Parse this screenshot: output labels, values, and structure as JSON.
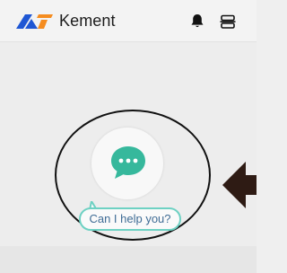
{
  "header": {
    "brand_name": "Kement",
    "icons": [
      "kement-logo-icon",
      "bell-icon",
      "menu-icon"
    ]
  },
  "chat": {
    "icon": "chat-bubble-icon",
    "help_text": "Can I help you?"
  },
  "colors": {
    "logo_blue": "#1f57d4",
    "logo_orange": "#f58c1f",
    "chat_green": "#36b89c",
    "tip_border": "#6ed1c3",
    "arrow": "#2e1b14"
  }
}
